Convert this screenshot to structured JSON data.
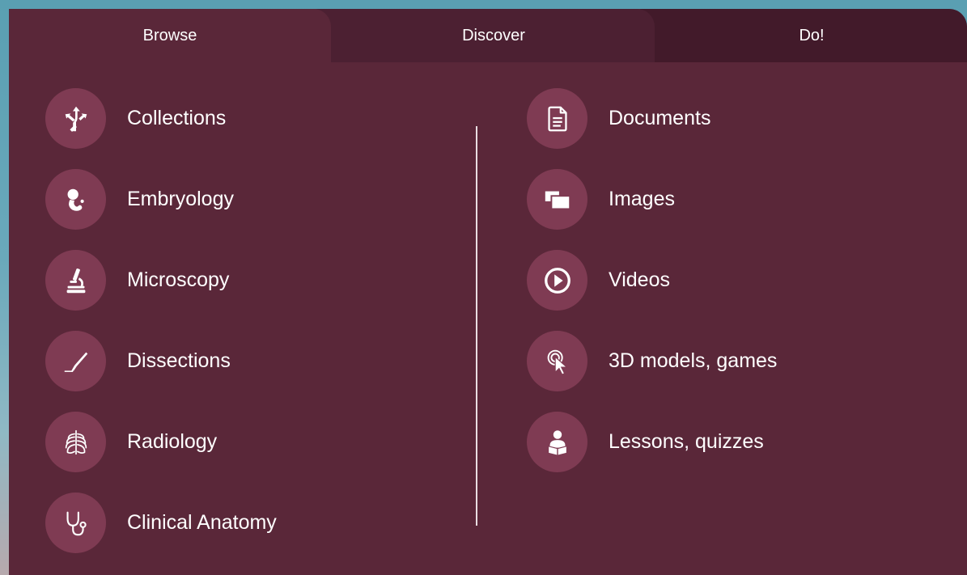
{
  "tabs": [
    {
      "label": "Browse",
      "active": true
    },
    {
      "label": "Discover",
      "active": false
    },
    {
      "label": "Do!",
      "active": false
    }
  ],
  "left_items": [
    {
      "label": "Collections",
      "icon": "directions-icon"
    },
    {
      "label": "Embryology",
      "icon": "fetus-icon"
    },
    {
      "label": "Microscopy",
      "icon": "microscope-icon"
    },
    {
      "label": "Dissections",
      "icon": "scalpel-icon"
    },
    {
      "label": "Radiology",
      "icon": "ribcage-icon"
    },
    {
      "label": "Clinical Anatomy",
      "icon": "stethoscope-icon"
    }
  ],
  "right_items": [
    {
      "label": "Documents",
      "icon": "document-icon"
    },
    {
      "label": "Images",
      "icon": "images-icon"
    },
    {
      "label": "Videos",
      "icon": "play-icon"
    },
    {
      "label": "3D models, games",
      "icon": "pointer-click-icon"
    },
    {
      "label": "Lessons, quizzes",
      "icon": "reader-icon"
    }
  ],
  "colors": {
    "panel": "#5a2739",
    "icon_circle": "#7f3b53",
    "text": "#ffffff"
  }
}
